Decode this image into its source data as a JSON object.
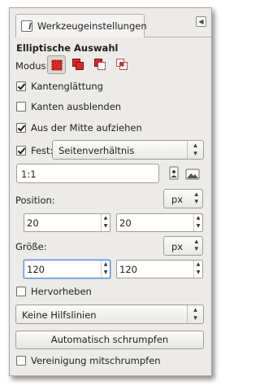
{
  "tab": {
    "label": "Werkzeugeinstellungen",
    "icon": "tool-options-icon",
    "menu_icon": "tab-menu-icon"
  },
  "title": "Elliptische Auswahl",
  "mode": {
    "label": "Modus:",
    "options": [
      {
        "name": "mode-replace-icon",
        "selected": true
      },
      {
        "name": "mode-add-icon",
        "selected": false
      },
      {
        "name": "mode-subtract-icon",
        "selected": false
      },
      {
        "name": "mode-intersect-icon",
        "selected": false
      }
    ]
  },
  "antialias": {
    "label": "Kantenglättung",
    "checked": true
  },
  "feather": {
    "label": "Kanten ausblenden",
    "checked": false
  },
  "expand_center": {
    "label": "Aus der Mitte aufziehen",
    "checked": true
  },
  "fixed": {
    "label": "Fest:",
    "checked": true,
    "value": "Seitenverhältnis"
  },
  "ratio": {
    "value": "1:1",
    "portrait_icon": "portrait-icon",
    "landscape_icon": "landscape-icon"
  },
  "position": {
    "label": "Position:",
    "x": "20",
    "y": "20",
    "unit": "px"
  },
  "size": {
    "label": "Größe:",
    "w": "120",
    "h": "120",
    "unit": "px"
  },
  "highlight": {
    "label": "Hervorheben",
    "checked": false
  },
  "guides": {
    "value": "Keine Hilfslinien"
  },
  "auto_shrink": {
    "label": "Automatisch schrumpfen"
  },
  "shrink_merged": {
    "label": "Vereinigung mitschrumpfen",
    "checked": false
  },
  "colors": {
    "accent": "#d8282a",
    "focus": "#5b8fd1",
    "panel": "#ecebe8"
  }
}
